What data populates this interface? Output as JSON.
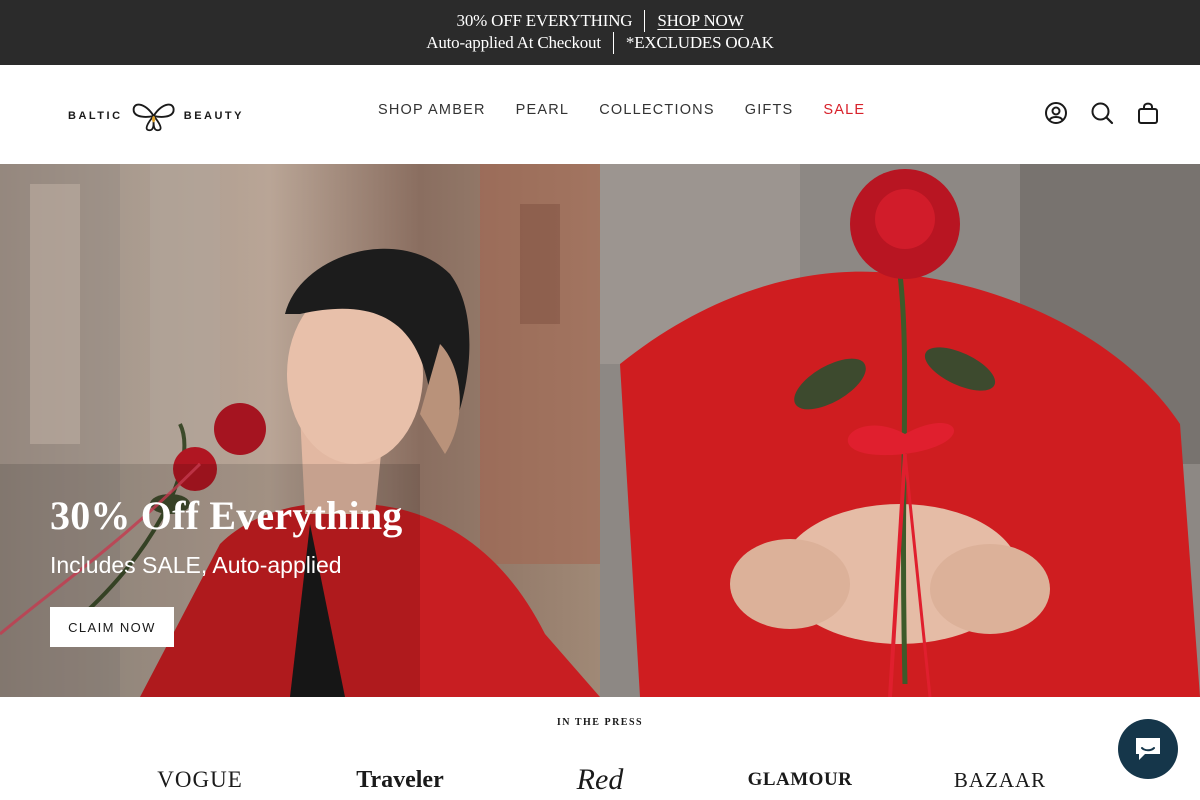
{
  "announcement": {
    "line1_text": "30% OFF EVERYTHING",
    "line1_link": "SHOP NOW",
    "line2_text": "Auto-applied At Checkout",
    "line2_note": "*EXCLUDES OOAK"
  },
  "brand": {
    "left": "BALTIC",
    "right": "BEAUTY"
  },
  "nav": {
    "items": [
      {
        "label": "SHOP AMBER"
      },
      {
        "label": "PEARL"
      },
      {
        "label": "COLLECTIONS"
      },
      {
        "label": "GIFTS"
      },
      {
        "label": "SALE"
      }
    ],
    "sale_color": "#d8212b"
  },
  "header_icons": [
    "account-icon",
    "search-icon",
    "cart-icon"
  ],
  "hero": {
    "title": "30% Off Everything",
    "subtitle": "Includes SALE, Auto-applied",
    "cta": "CLAIM NOW",
    "accent_red": "#d21e22"
  },
  "press": {
    "title": "IN THE PRESS",
    "logos": [
      "VOGUE",
      "Traveler",
      "Red",
      "GLAMOUR",
      "BAZAAR"
    ]
  },
  "chat": {
    "icon": "chat-icon",
    "color": "#15364a"
  }
}
